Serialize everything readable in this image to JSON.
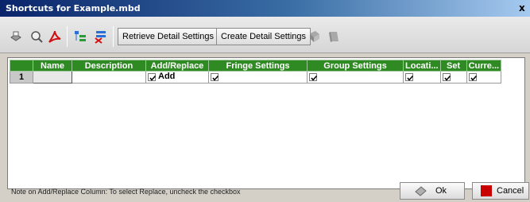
{
  "window": {
    "title": "Shortcuts for Example.mbd",
    "close_glyph": "x"
  },
  "toolbar": {
    "icons_left": [
      "print-icon",
      "print-preview-icon",
      "pdf-icon",
      "tree-expand-icon",
      "tree-delete-icon"
    ],
    "retrieve_label": "Retrieve Detail Settings",
    "create_label": "Create Detail Settings",
    "icons_right": [
      "book-icon-disabled",
      "book-icon-disabled"
    ]
  },
  "grid": {
    "columns": [
      "",
      "Name",
      "Description",
      "Add/Replace",
      "Fringe Settings",
      "Group Settings",
      "Locati...",
      "Set",
      "Curre..."
    ],
    "rows": [
      {
        "num": "1",
        "name": "",
        "description": "",
        "add_replace_label": "Add"
      }
    ],
    "header_color": "#2f8a24"
  },
  "status": {
    "note": "Note on Add/Replace Column: To select Replace, uncheck the checkbox"
  },
  "buttons": {
    "ok": "Ok",
    "cancel": "Cancel"
  }
}
